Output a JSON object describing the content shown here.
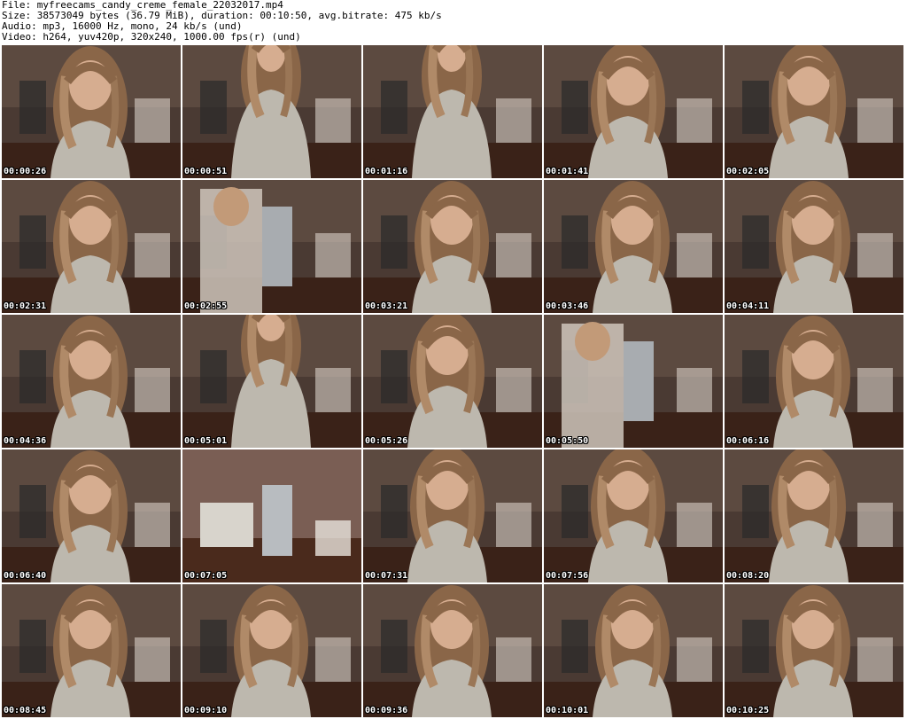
{
  "header": {
    "file_line": "File: myfreecams_candy_creme_female_22032017.mp4",
    "size_line": "Size: 38573049 bytes (36.79 MiB), duration: 00:10:50, avg.bitrate: 475 kb/s",
    "audio_line": "Audio: mp3, 16000 Hz, mono, 24 kb/s (und)",
    "video_line": "Video: h264, yuv420p, 320x240, 1000.00 fps(r) (und)"
  },
  "thumbnails": [
    {
      "timestamp": "00:00:26",
      "scene": "closeup"
    },
    {
      "timestamp": "00:00:51",
      "scene": "standing"
    },
    {
      "timestamp": "00:01:16",
      "scene": "standing"
    },
    {
      "timestamp": "00:01:41",
      "scene": "leaning"
    },
    {
      "timestamp": "00:02:05",
      "scene": "leaning"
    },
    {
      "timestamp": "00:02:31",
      "scene": "closeup"
    },
    {
      "timestamp": "00:02:55",
      "scene": "room"
    },
    {
      "timestamp": "00:03:21",
      "scene": "closeup"
    },
    {
      "timestamp": "00:03:46",
      "scene": "closeup"
    },
    {
      "timestamp": "00:04:11",
      "scene": "closeup"
    },
    {
      "timestamp": "00:04:36",
      "scene": "closeup"
    },
    {
      "timestamp": "00:05:01",
      "scene": "standing"
    },
    {
      "timestamp": "00:05:26",
      "scene": "leaning"
    },
    {
      "timestamp": "00:05:50",
      "scene": "room"
    },
    {
      "timestamp": "00:06:16",
      "scene": "closeup"
    },
    {
      "timestamp": "00:06:40",
      "scene": "closeup"
    },
    {
      "timestamp": "00:07:05",
      "scene": "empty-room"
    },
    {
      "timestamp": "00:07:31",
      "scene": "leaning"
    },
    {
      "timestamp": "00:07:56",
      "scene": "leaning"
    },
    {
      "timestamp": "00:08:20",
      "scene": "leaning"
    },
    {
      "timestamp": "00:08:45",
      "scene": "closeup"
    },
    {
      "timestamp": "00:09:10",
      "scene": "closeup"
    },
    {
      "timestamp": "00:09:36",
      "scene": "closeup"
    },
    {
      "timestamp": "00:10:01",
      "scene": "closeup"
    },
    {
      "timestamp": "00:10:25",
      "scene": "closeup"
    }
  ]
}
